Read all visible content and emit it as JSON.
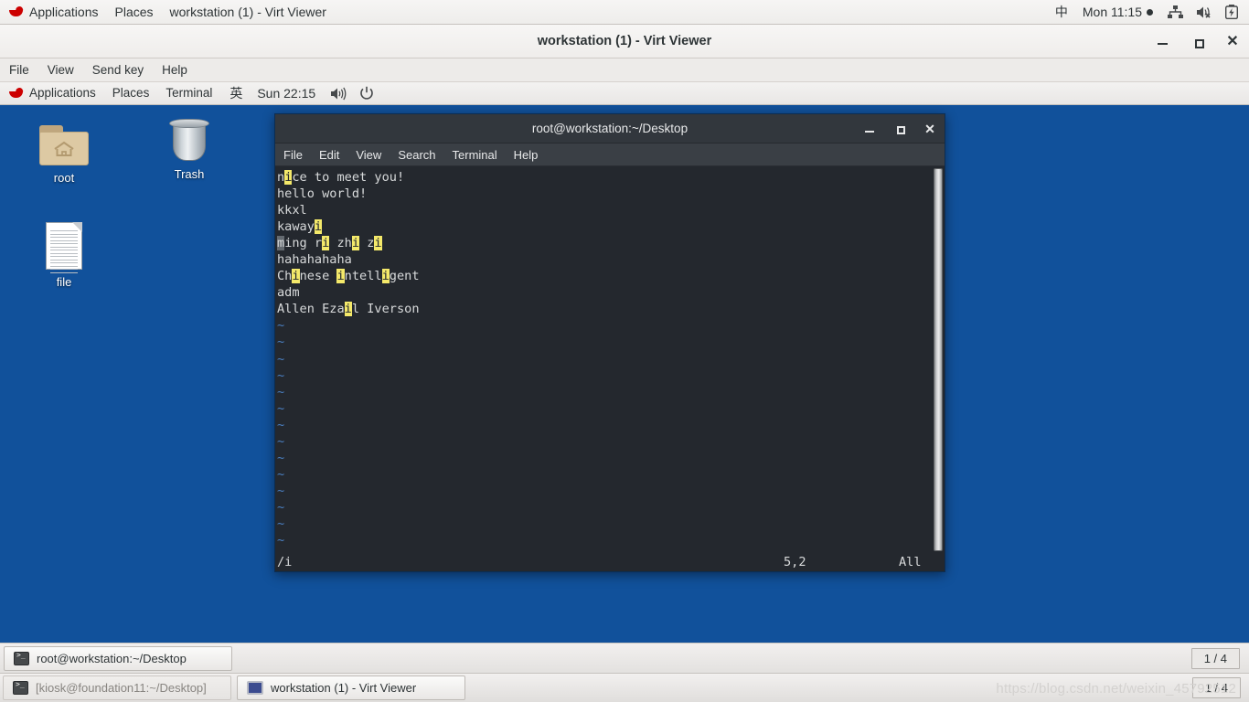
{
  "host_panel": {
    "logo": "redhat-logo",
    "applications": "Applications",
    "places": "Places",
    "window_title": "workstation (1) - Virt Viewer",
    "ime": "中",
    "clock": "Mon 11:15",
    "tray_icons": [
      "network-icon",
      "volume-muted-icon",
      "battery-icon"
    ]
  },
  "virt_viewer": {
    "title": "workstation (1) - Virt Viewer",
    "menu": [
      "File",
      "View",
      "Send key",
      "Help"
    ],
    "window_buttons": {
      "minimize": "minimize-icon",
      "maximize": "maximize-icon",
      "close": "close-icon"
    }
  },
  "guest_panel": {
    "logo": "redhat-logo",
    "applications": "Applications",
    "places": "Places",
    "terminal": "Terminal",
    "ime": "英",
    "clock": "Sun 22:15",
    "volume": "volume-icon",
    "power": "power-icon"
  },
  "desktop_icons": [
    {
      "name": "root",
      "icon": "home-folder-icon"
    },
    {
      "name": "Trash",
      "icon": "trash-icon"
    },
    {
      "name": "file",
      "icon": "document-icon"
    }
  ],
  "terminal": {
    "title": "root@workstation:~/Desktop",
    "menu": [
      "File",
      "Edit",
      "View",
      "Search",
      "Terminal",
      "Help"
    ],
    "window_buttons": {
      "minimize": "minimize-icon",
      "maximize": "maximize-icon",
      "close": "close-icon"
    },
    "lines": [
      [
        {
          "t": "n"
        },
        {
          "t": "i",
          "s": "hl"
        },
        {
          "t": "ce to meet you!"
        }
      ],
      [
        {
          "t": "hello world!"
        }
      ],
      [
        {
          "t": "kkxl"
        }
      ],
      [
        {
          "t": "kaway"
        },
        {
          "t": "i",
          "s": "hl"
        }
      ],
      [
        {
          "t": "m",
          "s": "cur"
        },
        {
          "t": "ing r"
        },
        {
          "t": "i",
          "s": "hl"
        },
        {
          "t": " zh"
        },
        {
          "t": "i",
          "s": "hl"
        },
        {
          "t": " z"
        },
        {
          "t": "i",
          "s": "hl"
        }
      ],
      [
        {
          "t": "hahahahaha"
        }
      ],
      [
        {
          "t": "Ch"
        },
        {
          "t": "i",
          "s": "hl"
        },
        {
          "t": "nese "
        },
        {
          "t": "i",
          "s": "hl"
        },
        {
          "t": "ntell"
        },
        {
          "t": "i",
          "s": "hl"
        },
        {
          "t": "gent"
        }
      ],
      [
        {
          "t": "adm"
        }
      ],
      [
        {
          "t": "Allen Eza"
        },
        {
          "t": "i",
          "s": "hl"
        },
        {
          "t": "l Iverson"
        }
      ],
      [
        {
          "t": "~",
          "s": "tilde"
        }
      ],
      [
        {
          "t": "~",
          "s": "tilde"
        }
      ],
      [
        {
          "t": "~",
          "s": "tilde"
        }
      ],
      [
        {
          "t": "~",
          "s": "tilde"
        }
      ],
      [
        {
          "t": "~",
          "s": "tilde"
        }
      ],
      [
        {
          "t": "~",
          "s": "tilde"
        }
      ],
      [
        {
          "t": "~",
          "s": "tilde"
        }
      ],
      [
        {
          "t": "~",
          "s": "tilde"
        }
      ],
      [
        {
          "t": "~",
          "s": "tilde"
        }
      ],
      [
        {
          "t": "~",
          "s": "tilde"
        }
      ],
      [
        {
          "t": "~",
          "s": "tilde"
        }
      ],
      [
        {
          "t": "~",
          "s": "tilde"
        }
      ],
      [
        {
          "t": "~",
          "s": "tilde"
        }
      ],
      [
        {
          "t": "~",
          "s": "tilde"
        }
      ]
    ],
    "status": {
      "command": "/i",
      "position": "5,2",
      "scroll": "All"
    },
    "colors": {
      "background": "#24282e",
      "foreground": "#d8dadb",
      "highlight": "#f4e96a",
      "tilde": "#4a7fc1"
    }
  },
  "guest_taskbar": {
    "window_label": "root@workstation:~/Desktop",
    "workspace": "1 / 4"
  },
  "host_taskbar": {
    "items": [
      {
        "label": "[kiosk@foundation11:~/Desktop]",
        "icon": "terminal-icon",
        "active": false
      },
      {
        "label": "workstation (1) - Virt Viewer",
        "icon": "monitor-icon",
        "active": true
      }
    ],
    "workspace": "1 / 4"
  },
  "watermark": "https://blog.csdn.net/weixin_45792512"
}
